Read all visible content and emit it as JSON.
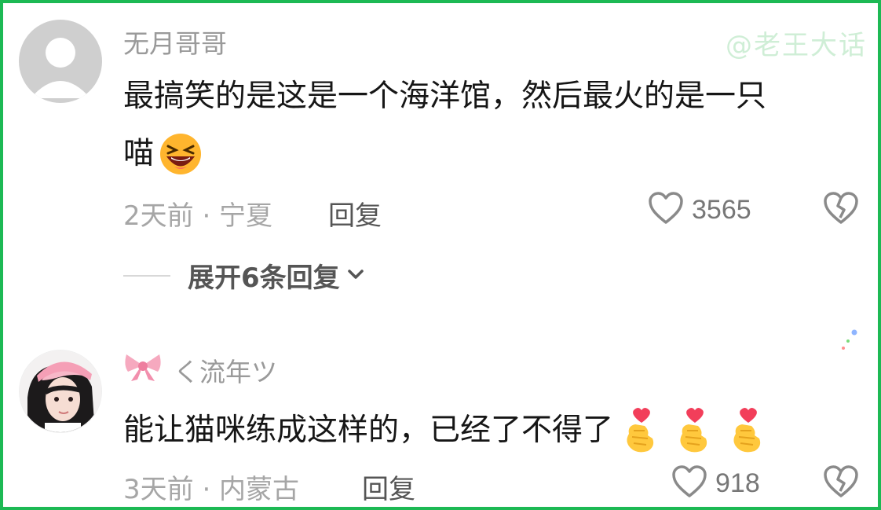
{
  "watermark": "@老王大话",
  "comments": [
    {
      "username": "无月哥哥",
      "text_line1": "最搞笑的是这是一个海洋馆，然后最火的是一只",
      "text_line2": "喵",
      "time_location": "2天前 · 宁夏",
      "reply_label": "回复",
      "likes": "3565",
      "expand_label": "展开6条回复"
    },
    {
      "username": "く流年ツ",
      "text": "能让猫咪练成这样的，已经了不得了",
      "time_location": "3天前 · 内蒙古",
      "reply_label": "回复",
      "likes": "918"
    }
  ],
  "icons": {
    "laugh": "grinning-squinting-emoji",
    "heart": "heart-outline-icon",
    "broken_heart": "broken-heart-icon",
    "bow": "pink-bow-emoji",
    "finger_heart": "finger-heart-emoji",
    "chevron": "chevron-down-icon"
  },
  "colors": {
    "border": "#1db954",
    "watermark": "#cfeed6"
  }
}
